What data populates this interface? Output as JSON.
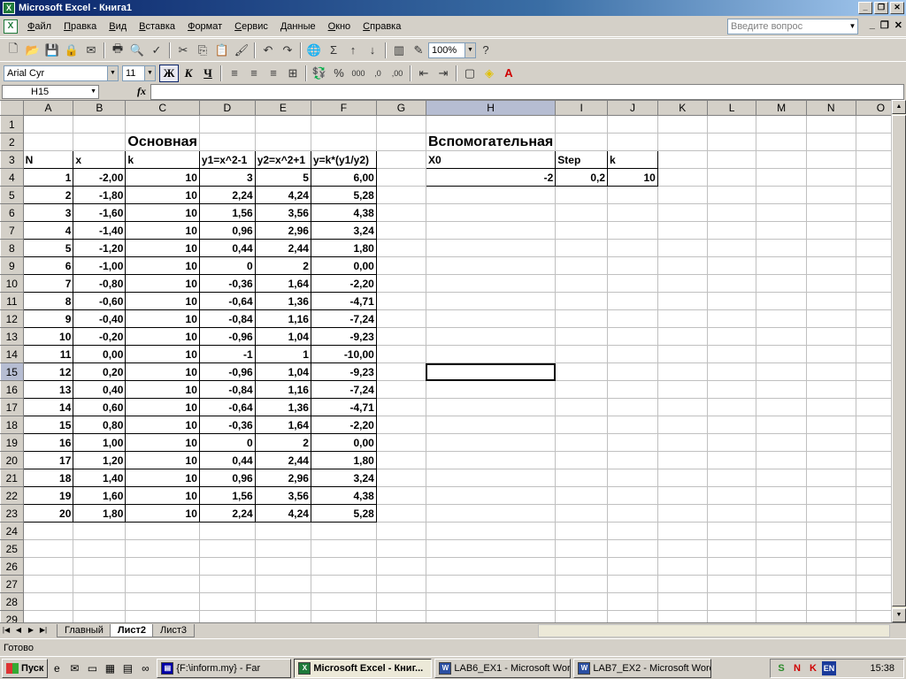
{
  "window": {
    "title": "Microsoft Excel - Книга1"
  },
  "menu": {
    "items": [
      "Файл",
      "Правка",
      "Вид",
      "Вставка",
      "Формат",
      "Сервис",
      "Данные",
      "Окно",
      "Справка"
    ],
    "ask_placeholder": "Введите вопрос"
  },
  "toolbar": {
    "zoom": "100%"
  },
  "format_toolbar": {
    "font": "Arial Cyr",
    "size": "11",
    "bold": "Ж",
    "italic": "К",
    "underline": "Ч"
  },
  "formula_bar": {
    "name_box": "H15",
    "fx": "fx",
    "content": ""
  },
  "sheet": {
    "columns": [
      "A",
      "B",
      "C",
      "D",
      "E",
      "F",
      "G",
      "H",
      "I",
      "J",
      "K",
      "L",
      "M",
      "N",
      "O"
    ],
    "active_column": "H",
    "active_row": 15,
    "title_main": "Основная",
    "title_aux": "Вспомогательная",
    "headers_main": [
      "N",
      "x",
      "k",
      "y1=x^2-1",
      "y2=x^2+1",
      "y=k*(y1/y2)"
    ],
    "headers_aux": [
      "X0",
      "Step",
      "k"
    ],
    "aux_values": [
      "-2",
      "0,2",
      "10"
    ],
    "rows": [
      [
        "1",
        "-2,00",
        "10",
        "3",
        "5",
        "6,00"
      ],
      [
        "2",
        "-1,80",
        "10",
        "2,24",
        "4,24",
        "5,28"
      ],
      [
        "3",
        "-1,60",
        "10",
        "1,56",
        "3,56",
        "4,38"
      ],
      [
        "4",
        "-1,40",
        "10",
        "0,96",
        "2,96",
        "3,24"
      ],
      [
        "5",
        "-1,20",
        "10",
        "0,44",
        "2,44",
        "1,80"
      ],
      [
        "6",
        "-1,00",
        "10",
        "0",
        "2",
        "0,00"
      ],
      [
        "7",
        "-0,80",
        "10",
        "-0,36",
        "1,64",
        "-2,20"
      ],
      [
        "8",
        "-0,60",
        "10",
        "-0,64",
        "1,36",
        "-4,71"
      ],
      [
        "9",
        "-0,40",
        "10",
        "-0,84",
        "1,16",
        "-7,24"
      ],
      [
        "10",
        "-0,20",
        "10",
        "-0,96",
        "1,04",
        "-9,23"
      ],
      [
        "11",
        "0,00",
        "10",
        "-1",
        "1",
        "-10,00"
      ],
      [
        "12",
        "0,20",
        "10",
        "-0,96",
        "1,04",
        "-9,23"
      ],
      [
        "13",
        "0,40",
        "10",
        "-0,84",
        "1,16",
        "-7,24"
      ],
      [
        "14",
        "0,60",
        "10",
        "-0,64",
        "1,36",
        "-4,71"
      ],
      [
        "15",
        "0,80",
        "10",
        "-0,36",
        "1,64",
        "-2,20"
      ],
      [
        "16",
        "1,00",
        "10",
        "0",
        "2",
        "0,00"
      ],
      [
        "17",
        "1,20",
        "10",
        "0,44",
        "2,44",
        "1,80"
      ],
      [
        "18",
        "1,40",
        "10",
        "0,96",
        "2,96",
        "3,24"
      ],
      [
        "19",
        "1,60",
        "10",
        "1,56",
        "3,56",
        "4,38"
      ],
      [
        "20",
        "1,80",
        "10",
        "2,24",
        "4,24",
        "5,28"
      ]
    ]
  },
  "tabs": [
    "Главный",
    "Лист2",
    "Лист3"
  ],
  "active_tab": "Лист2",
  "status": "Готово",
  "taskbar": {
    "start": "Пуск",
    "items": [
      "{F:\\inform.my} - Far",
      "Microsoft Excel - Книг...",
      "LAB6_EX1 - Microsoft Word",
      "LAB7_EX2 - Microsoft Word"
    ],
    "tray_lang": "EN",
    "clock": "15:38"
  }
}
